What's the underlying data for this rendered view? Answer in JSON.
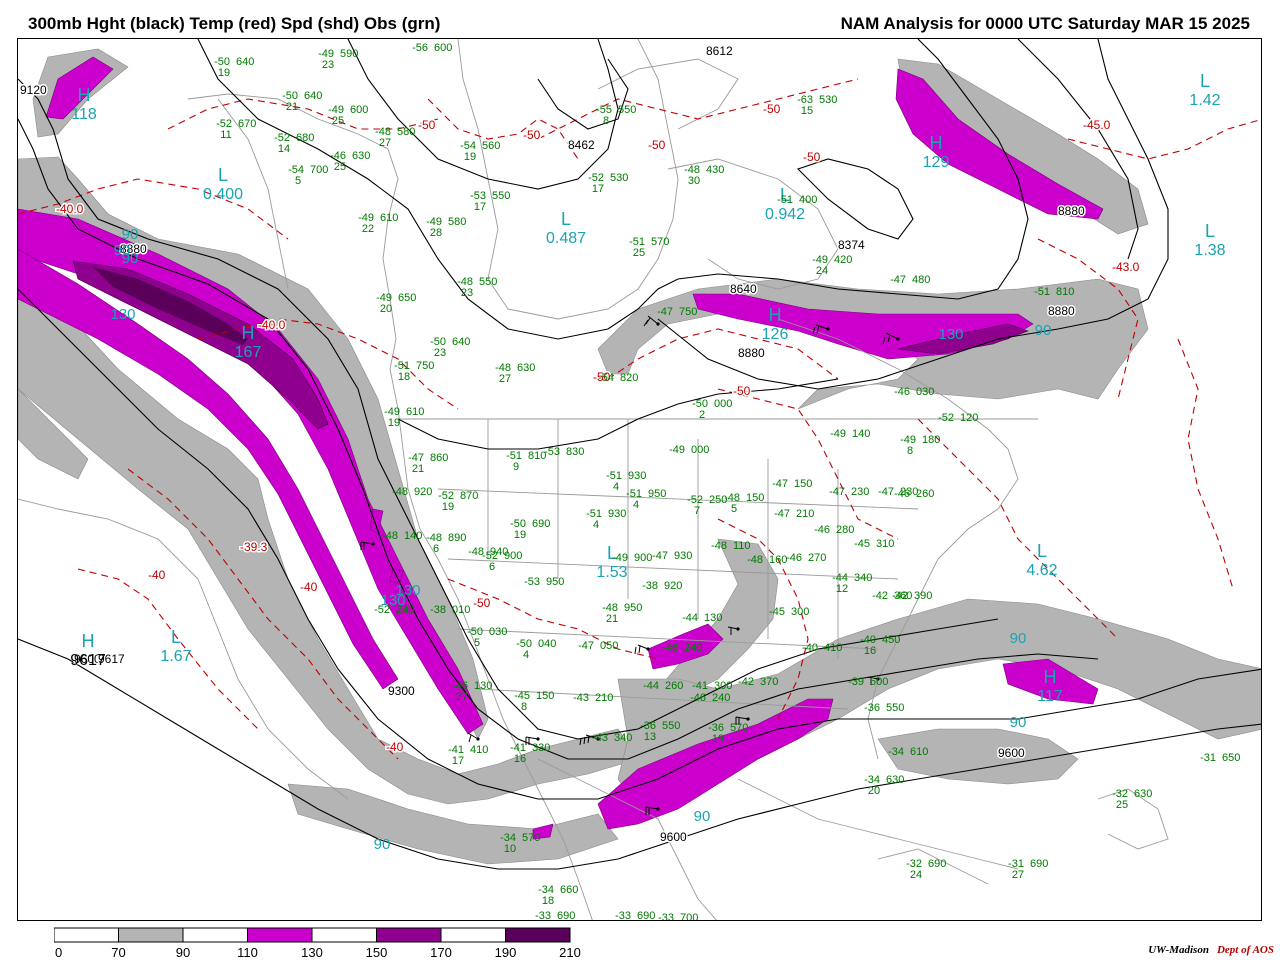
{
  "header": {
    "title_left": "300mb Hght (black) Temp (red) Spd (shd) Obs (grn)",
    "title_right": "NAM Analysis for 0000 UTC Saturday  MAR 15 2025"
  },
  "colors": {
    "height_contour": "#000000",
    "temperature_contour": "#c00000",
    "speed_70_90": "#b4b4b4",
    "speed_110_130": "#cc00cc",
    "speed_130_150": "#cc00cc",
    "speed_150_170": "#8f008f",
    "speed_190_210": "#5a005a",
    "hl_labels": "#1aa3b0",
    "observations": "#007a00",
    "geography": "#999999"
  },
  "colorbar": {
    "ticks": [
      "0",
      "70",
      "90",
      "110",
      "130",
      "150",
      "170",
      "190",
      "210"
    ],
    "segment_colors": [
      "#ffffff",
      "#b4b4b4",
      "#ffffff",
      "#cc00cc",
      "#ffffff",
      "#8f008f",
      "#ffffff",
      "#5a005a"
    ]
  },
  "height_labels": [
    "9120",
    "8880",
    "8612",
    "8462",
    "8374",
    "8640",
    "8880",
    "8880",
    "9300",
    "9600",
    "9600",
    "9600",
    "9617",
    "8880"
  ],
  "temperature_labels": [
    "-40.0",
    "-40.0",
    "-39.3",
    "-40",
    "-40",
    "-40",
    "-50",
    "-50",
    "-50",
    "-50",
    "-50",
    "-50",
    "-50",
    "-50",
    "-45.0",
    "-43.0"
  ],
  "hl_markers": [
    {
      "letter": "H",
      "value": "118"
    },
    {
      "letter": "L",
      "value": "0.400"
    },
    {
      "letter": "L",
      "value": "0.487"
    },
    {
      "letter": "L",
      "value": "0.942"
    },
    {
      "letter": "L",
      "value": "1.42"
    },
    {
      "letter": "L",
      "value": "1.38"
    },
    {
      "letter": "H",
      "value": "167"
    },
    {
      "letter": "H",
      "value": "126"
    },
    {
      "letter": "H",
      "value": "129"
    },
    {
      "letter": "L",
      "value": "1.53"
    },
    {
      "letter": "L",
      "value": "4.62"
    },
    {
      "letter": "H",
      "value": "117"
    },
    {
      "letter": "H",
      "value": "9617"
    },
    {
      "letter": "L",
      "value": "1.67"
    }
  ],
  "speed_labels": [
    "90",
    "90",
    "130",
    "130",
    "130",
    "90",
    "90",
    "90",
    "90",
    "90",
    "90",
    "130"
  ],
  "observations": [
    {
      "t": "-50",
      "z": "640",
      "d": "19"
    },
    {
      "t": "-49",
      "z": "590",
      "d": "23"
    },
    {
      "t": "-56",
      "z": "600",
      "d": ""
    },
    {
      "t": "-50",
      "z": "640",
      "d": "21"
    },
    {
      "t": "-49",
      "z": "600",
      "d": "25"
    },
    {
      "t": "-52",
      "z": "670",
      "d": "11"
    },
    {
      "t": "-52",
      "z": "680",
      "d": "14"
    },
    {
      "t": "-48",
      "z": "580",
      "d": "27"
    },
    {
      "t": "-46",
      "z": "630",
      "d": "25"
    },
    {
      "t": "-54",
      "z": "700",
      "d": "5"
    },
    {
      "t": "-54",
      "z": "560",
      "d": "19"
    },
    {
      "t": "-55",
      "z": "550",
      "d": "8"
    },
    {
      "t": "-52",
      "z": "530",
      "d": "17"
    },
    {
      "t": "-48",
      "z": "430",
      "d": "30"
    },
    {
      "t": "-63",
      "z": "530",
      "d": "15"
    },
    {
      "t": "-53",
      "z": "550",
      "d": "17"
    },
    {
      "t": "-49",
      "z": "610",
      "d": "22"
    },
    {
      "t": "-49",
      "z": "580",
      "d": "28"
    },
    {
      "t": "-51",
      "z": "570",
      "d": "25"
    },
    {
      "t": "-51",
      "z": "400",
      "d": ""
    },
    {
      "t": "-49",
      "z": "420",
      "d": "24"
    },
    {
      "t": "-48",
      "z": "550",
      "d": "23"
    },
    {
      "t": "-47",
      "z": "480",
      "d": ""
    },
    {
      "t": "-51",
      "z": "810",
      "d": ""
    },
    {
      "t": "-49",
      "z": "650",
      "d": "20"
    },
    {
      "t": "-50",
      "z": "640",
      "d": "23"
    },
    {
      "t": "-48",
      "z": "630",
      "d": "27"
    },
    {
      "t": "-54",
      "z": "820",
      "d": ""
    },
    {
      "t": "-47",
      "z": "750",
      "d": ""
    },
    {
      "t": "-51",
      "z": "750",
      "d": "18"
    },
    {
      "t": "-50",
      "z": "000",
      "d": "2"
    },
    {
      "t": "-49",
      "z": "610",
      "d": "19"
    },
    {
      "t": "-46",
      "z": "030",
      "d": ""
    },
    {
      "t": "-49",
      "z": "000",
      "d": ""
    },
    {
      "t": "-51",
      "z": "810",
      "d": "9"
    },
    {
      "t": "-53",
      "z": "830",
      "d": ""
    },
    {
      "t": "-49",
      "z": "140",
      "d": ""
    },
    {
      "t": "-49",
      "z": "180",
      "d": "8"
    },
    {
      "t": "-52",
      "z": "120",
      "d": ""
    },
    {
      "t": "-47",
      "z": "860",
      "d": "21"
    },
    {
      "t": "-51",
      "z": "930",
      "d": "4"
    },
    {
      "t": "-52",
      "z": "870",
      "d": "19"
    },
    {
      "t": "-48",
      "z": "920",
      "d": ""
    },
    {
      "t": "-51",
      "z": "950",
      "d": "4"
    },
    {
      "t": "-52",
      "z": "250",
      "d": "7"
    },
    {
      "t": "-48",
      "z": "150",
      "d": "5"
    },
    {
      "t": "-47",
      "z": "150",
      "d": ""
    },
    {
      "t": "-47",
      "z": "230",
      "d": ""
    },
    {
      "t": "-47",
      "z": "230",
      "d": ""
    },
    {
      "t": "-46",
      "z": "260",
      "d": ""
    },
    {
      "t": "-50",
      "z": "690",
      "d": "19"
    },
    {
      "t": "-51",
      "z": "930",
      "d": "4"
    },
    {
      "t": "-47",
      "z": "210",
      "d": ""
    },
    {
      "t": "-46",
      "z": "280",
      "d": ""
    },
    {
      "t": "-45",
      "z": "310",
      "d": ""
    },
    {
      "t": "-48",
      "z": "890",
      "d": "6"
    },
    {
      "t": "-48",
      "z": "940",
      "d": ""
    },
    {
      "t": "-52",
      "z": "900",
      "d": "6"
    },
    {
      "t": "-49",
      "z": "900",
      "d": ""
    },
    {
      "t": "-47",
      "z": "930",
      "d": ""
    },
    {
      "t": "-48",
      "z": "110",
      "d": ""
    },
    {
      "t": "-48",
      "z": "160",
      "d": ""
    },
    {
      "t": "-46",
      "z": "270",
      "d": ""
    },
    {
      "t": "-44",
      "z": "340",
      "d": "12"
    },
    {
      "t": "-42",
      "z": "360",
      "d": ""
    },
    {
      "t": "-42",
      "z": "390",
      "d": ""
    },
    {
      "t": "-48",
      "z": "140",
      "d": ""
    },
    {
      "t": "-53",
      "z": "950",
      "d": ""
    },
    {
      "t": "-38",
      "z": "010",
      "d": ""
    },
    {
      "t": "-38",
      "z": "920",
      "d": ""
    },
    {
      "t": "-48",
      "z": "950",
      "d": "21"
    },
    {
      "t": "-44",
      "z": "130",
      "d": ""
    },
    {
      "t": "-45",
      "z": "300",
      "d": ""
    },
    {
      "t": "-40",
      "z": "450",
      "d": "16"
    },
    {
      "t": "-52",
      "z": "240",
      "d": ""
    },
    {
      "t": "-50",
      "z": "030",
      "d": "5"
    },
    {
      "t": "-50",
      "z": "040",
      "d": "4"
    },
    {
      "t": "-47",
      "z": "050",
      "d": ""
    },
    {
      "t": "-46",
      "z": "240",
      "d": ""
    },
    {
      "t": "-40",
      "z": "410",
      "d": ""
    },
    {
      "t": "-39",
      "z": "500",
      "d": ""
    },
    {
      "t": "-46",
      "z": "240",
      "d": ""
    },
    {
      "t": "-46",
      "z": "130",
      "d": "27"
    },
    {
      "t": "-45",
      "z": "150",
      "d": "8"
    },
    {
      "t": "-43",
      "z": "210",
      "d": ""
    },
    {
      "t": "-44",
      "z": "260",
      "d": ""
    },
    {
      "t": "-41",
      "z": "300",
      "d": ""
    },
    {
      "t": "-42",
      "z": "370",
      "d": ""
    },
    {
      "t": "-36",
      "z": "550",
      "d": "13"
    },
    {
      "t": "-36",
      "z": "570",
      "d": "19"
    },
    {
      "t": "-41",
      "z": "410",
      "d": "17"
    },
    {
      "t": "-41",
      "z": "330",
      "d": "16"
    },
    {
      "t": "-43",
      "z": "340",
      "d": ""
    },
    {
      "t": "-34",
      "z": "610",
      "d": ""
    },
    {
      "t": "-34",
      "z": "630",
      "d": "20"
    },
    {
      "t": "-31",
      "z": "650",
      "d": ""
    },
    {
      "t": "-36",
      "z": "550",
      "d": ""
    },
    {
      "t": "-32",
      "z": "630",
      "d": "25"
    },
    {
      "t": "-34",
      "z": "570",
      "d": "10"
    },
    {
      "t": "-34",
      "z": "660",
      "d": "18"
    },
    {
      "t": "-32",
      "z": "690",
      "d": "24"
    },
    {
      "t": "-31",
      "z": "690",
      "d": "27"
    },
    {
      "t": "-33",
      "z": "690",
      "d": ""
    },
    {
      "t": "-33",
      "z": "700",
      "d": ""
    },
    {
      "t": "-33",
      "z": "690",
      "d": ""
    }
  ],
  "credit": {
    "org": "UW-Madison",
    "dept": "Dept of AOS"
  }
}
